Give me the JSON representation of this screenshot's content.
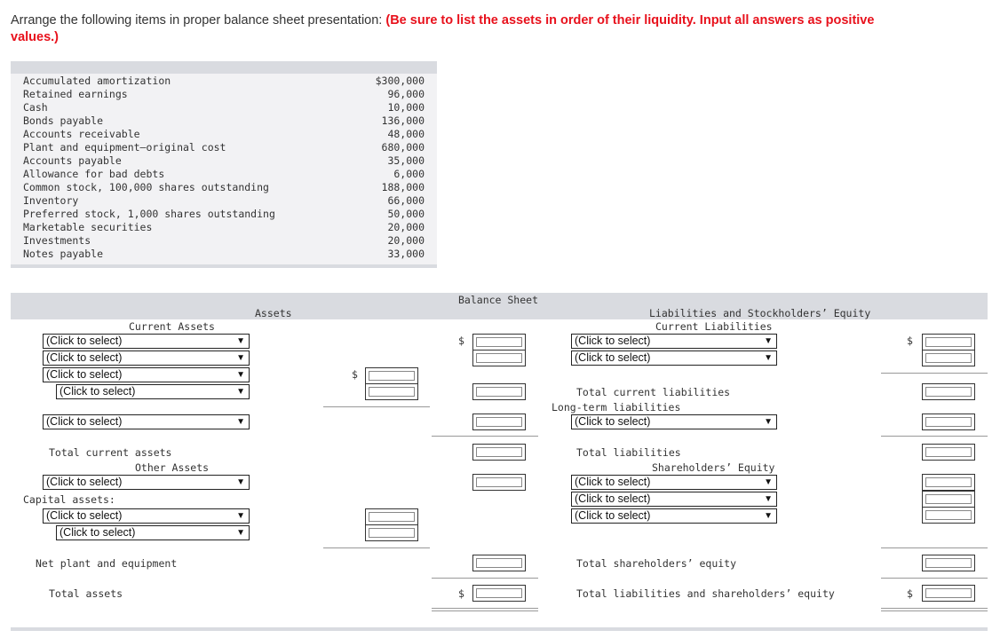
{
  "instructions": {
    "lead": "Arrange the following items in proper balance sheet presentation: ",
    "emphasis": "(Be sure to list the assets in order of their liquidity. Input all answers as positive values.)"
  },
  "items": [
    {
      "label": "Accumulated amortization",
      "value": "$300,000"
    },
    {
      "label": "Retained earnings",
      "value": "96,000"
    },
    {
      "label": "Cash",
      "value": "10,000"
    },
    {
      "label": "Bonds payable",
      "value": "136,000"
    },
    {
      "label": "Accounts receivable",
      "value": "48,000"
    },
    {
      "label": "Plant and equipment—original cost",
      "value": "680,000"
    },
    {
      "label": "Accounts payable",
      "value": "35,000"
    },
    {
      "label": "Allowance for bad debts",
      "value": "6,000"
    },
    {
      "label": "Common stock, 100,000 shares outstanding",
      "value": "188,000"
    },
    {
      "label": "Inventory",
      "value": "66,000"
    },
    {
      "label": "Preferred stock, 1,000 shares outstanding",
      "value": "50,000"
    },
    {
      "label": "Marketable securities",
      "value": "20,000"
    },
    {
      "label": "Investments",
      "value": "20,000"
    },
    {
      "label": "Notes payable",
      "value": "33,000"
    }
  ],
  "sheet": {
    "title": "Balance Sheet",
    "assets_header": "Assets",
    "liab_header": "Liabilities and Stockholders’ Equity",
    "current_assets": "Current Assets",
    "current_liabilities": "Current Liabilities",
    "total_current_assets": "Total current assets",
    "other_assets": "Other Assets",
    "capital_assets": "Capital assets:",
    "net_plant": "Net plant and equipment",
    "total_assets": "Total assets",
    "total_current_liabilities": "Total current liabilities",
    "long_term_liabilities": "Long-term liabilities",
    "total_liabilities": "Total liabilities",
    "shareholders_equity": "Shareholders’ Equity",
    "total_shareholders_equity": "Total shareholders’ equity",
    "total_liab_equity": "Total liabilities and shareholders’ equity",
    "select_placeholder": "(Click to select)",
    "currency": "$"
  }
}
